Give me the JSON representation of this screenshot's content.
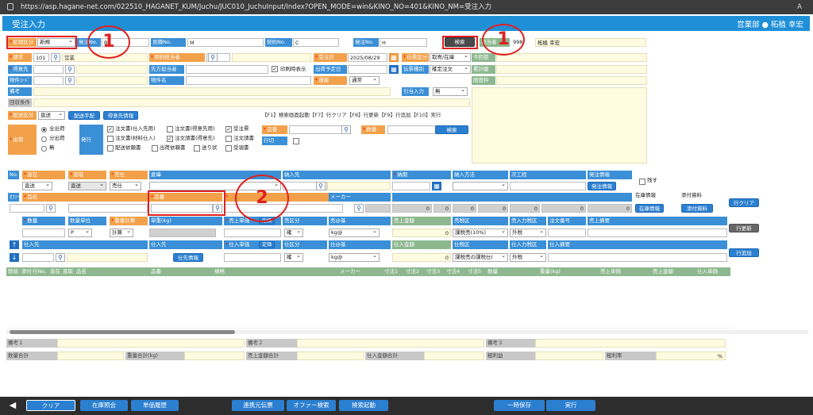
{
  "browser": {
    "url": "https://asp.hagane-net.com/022510_HAGANET_KUM/Juchu/JUC010_JuchuInput/Index?OPEN_MODE=win&KINO_NO=401&KINO_NM=受注入力",
    "aa": "A"
  },
  "app": {
    "title": "受注入力",
    "dept": "営業部",
    "user": "柘植 幸宏"
  },
  "header": {
    "shori_label": "処理区分",
    "shori_value": "新規",
    "hacchu_label": "発注No.",
    "hacchu_value": "B",
    "mitsumori_label": "見積No.",
    "mitsumori_value": "M",
    "keiyaku_label": "契約No.",
    "keiyaku_value": "C",
    "hacchuNo2_label": "発注No.",
    "hacchuNo2_value": "H",
    "search_btn": "検索",
    "tanto_label": "担当者",
    "tanto_code": "998",
    "tanto_name": "柘植 幸宏"
  },
  "row1": {
    "seikyu_label": "請求",
    "seikyu_value": "101",
    "eigyo_label": "営業",
    "keiyaku_tanto": "契約担当者",
    "juchubi_label": "受注日",
    "juchubi_value": "2025/08/29",
    "denpyo_label": "伝票区分",
    "denpyo_value": "取寄/在庫"
  },
  "row2": {
    "tokuisaki": "得意先",
    "sakitanto": "先方担当者",
    "insatsu": "印刷時表示",
    "shukka_yotei": "出荷予定日",
    "denpyo_shubetsu": "伝票種別",
    "denpyo_shubetsu_value": "確定注文"
  },
  "row3": {
    "bukken_code": "物件ｺｰﾄﾞ",
    "bukken_name": "物件名",
    "unso": "運搬",
    "unso_value": "通常"
  },
  "row4": {
    "biko": "備考",
    "hikiate": "引当入力",
    "hikiate_value": "無"
  },
  "row5": {
    "kaishu": "回収条件"
  },
  "right_panel": {
    "konkai": "今回使",
    "ruikei": "累計額",
    "gendo": "限度枠"
  },
  "haiso": {
    "label": "配送区分",
    "value": "直送",
    "tehai_btn": "配送手配",
    "tokui_btn": "得意先情報",
    "fkeys": "【F1】検索画面起動【F7】行クリア【F8】行更新【F9】行追加【F10】実行"
  },
  "shukka": {
    "label": "出荷",
    "opt1": "全出荷",
    "opt2": "分出荷",
    "opt3": "無",
    "hakko": "発行",
    "c1": "注文書(仕入先用)",
    "c2": "注文書(得意先用)",
    "c3": "受注票",
    "c4": "注文書(材料仕入)",
    "c5": "注文請書(得意先)",
    "c6": "注文請書",
    "c7": "配送依頼書",
    "c8": "出荷依頼書",
    "c9": "送り状",
    "c10": "受領書",
    "hinban": "品番",
    "suryo": "数量",
    "search_btn": "検索",
    "gyoki": "行切"
  },
  "detail": {
    "no": "No.",
    "choku": "直在",
    "toritsugi": "直取",
    "shiire": "売仕",
    "soko": "倉庫",
    "nonyusaki": "納入先",
    "noki": "納期",
    "nonyu_hoho": "納入方法",
    "jikotei": "次工程",
    "hacchu_joho": "発注情報",
    "nokosu": "残す",
    "v_choku": "直送",
    "v_toritsugi": "直送",
    "v_shiire": "売仕",
    "hacchu_btn": "発注情報",
    "offer": "ｵﾌｧｰ",
    "hinmei": "品名",
    "hinban": "品番",
    "maker": "メーカー",
    "zaiko": "在庫情報",
    "tempu": "添付資料",
    "zaiko_btn": "在庫情報",
    "tempu_btn": "添付資料",
    "zeros": [
      "0",
      "0",
      "0",
      "0",
      "0",
      "0",
      "0",
      "0"
    ],
    "suryo": "数量",
    "suryo_tani": "数量単位",
    "juryo_keisan": "重量計算",
    "juryo": "単重(kg)",
    "uri_tanka": "売上単価",
    "teika": "定価",
    "uri_kubun": "売区分",
    "uri_kijun": "売@基",
    "uri_kingaku": "売上金額",
    "uri_zei": "売税区",
    "uri_nyuryoku": "売入力税区",
    "chumon_no": "注文番号",
    "uri_tekiyo": "売上摘要",
    "v_tani": "P",
    "v_keisan": "計算",
    "v_kubun": "確",
    "v_kijun": "kg@",
    "v_kingaku": "0",
    "v_zei": "課税売(10%)",
    "v_nyu": "外税",
    "shiiresaki": "仕入先",
    "shiire_joho": "仕入先",
    "shiire_btn": "仕先情報",
    "shiire_tanka": "仕入単価",
    "teika2": "定価",
    "shi_kubun": "仕区分",
    "shi_kijun": "仕@基",
    "shi_kingaku": "仕入金額",
    "shi_zei": "仕税区",
    "shi_nyuryoku": "仕入力税区",
    "shi_tekiyo": "仕入摘要",
    "v_zei2": "課税売の課税仕(",
    "row_clear": "行クリア",
    "row_update": "行更新",
    "row_add": "行追加"
  },
  "grid_headers": [
    "削除",
    "添付",
    "行No.",
    "直在",
    "直取",
    "品名",
    "品番",
    "規格",
    "メーカー",
    "寸法1",
    "寸法2",
    "寸法3",
    "寸法4",
    "寸法5",
    "数量",
    "重量(kg)",
    "売上単価",
    "売上金額",
    "仕入単価"
  ],
  "footer": {
    "biko1": "備考１",
    "biko2": "備考２",
    "biko3": "備考３",
    "suryo_gokei": "数量合計",
    "juryo_gokei": "重量合計(kg)",
    "uri_gokei": "売上金額合計",
    "shi_gokei": "仕入金額合計",
    "arari": "粗利益",
    "arari_ritsu": "粗利率",
    "pct": "%"
  },
  "bottom": {
    "back": "◀",
    "clear": "クリア",
    "zaiko": "在庫照会",
    "tanka": "単価履歴",
    "renkei": "連携元伝票",
    "offer": "オファー検索",
    "kensaku": "検索起動",
    "ichiji": "一時保存",
    "jikko": "実行"
  },
  "annotations": {
    "n1a": "1",
    "n1b": "1",
    "n2": "2"
  },
  "colors": {
    "accent": "#1f8fd8",
    "orange": "#f2a14a",
    "green": "#8db88f",
    "annotation": "#e02020"
  }
}
